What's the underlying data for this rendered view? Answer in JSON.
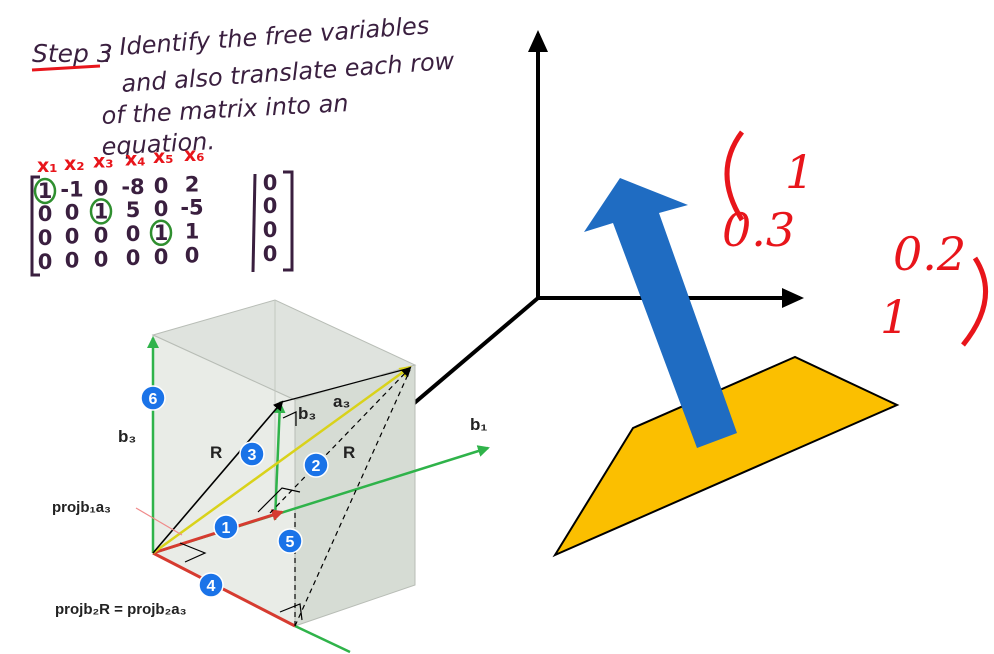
{
  "notes": {
    "step_label": "Step 3",
    "step_colon": ":",
    "lines": [
      "Identify the free variables",
      "and also translate each row",
      "of the matrix into an",
      "equation."
    ]
  },
  "matrix": {
    "headers": [
      "x₁",
      "x₂",
      "x₃",
      "x₄",
      "x₅",
      "x₆"
    ],
    "rows": [
      [
        "1",
        "-1",
        "0",
        "-8",
        "0",
        "2",
        "0"
      ],
      [
        "0",
        "0",
        "1",
        "5",
        "0",
        "-5",
        "0"
      ],
      [
        "0",
        "0",
        "0",
        "0",
        "1",
        "1",
        "0"
      ],
      [
        "0",
        "0",
        "0",
        "0",
        "0",
        "0",
        "0"
      ]
    ],
    "pivots": [
      "0-0",
      "1-2",
      "2-4"
    ]
  },
  "red_matrix": {
    "top_left": "1",
    "mid_left": "0.3",
    "mid_right": "0.2",
    "bottom_right": "1"
  },
  "diagram": {
    "labels": {
      "b3_left": "b₃",
      "b3_top": "b₃",
      "a3": "a₃",
      "b1": "b₁",
      "R1": "R",
      "R2": "R",
      "proj1": "projb₁a₃",
      "proj2": "projb₂R = projb₂a₃"
    },
    "badges": [
      "1",
      "2",
      "3",
      "4",
      "5",
      "6"
    ]
  },
  "colors": {
    "red_ink": "#e8151b",
    "dark_ink": "#3a1f3f",
    "badge": "#1a73e8",
    "green": "#2fb34a",
    "yellow": "#d9d21a",
    "red_arrow": "#d63b30",
    "blue_arrow": "#1f6cc2",
    "plane": "#fbbf00"
  }
}
